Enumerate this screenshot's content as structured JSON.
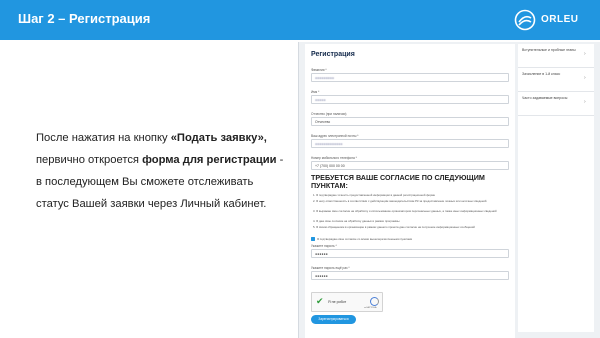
{
  "slide": {
    "title": "Шаг 2 – Регистрация",
    "logo_text": "ORLEU"
  },
  "description": {
    "line1_pre": "После нажатия на кнопку ",
    "line1_bold": "«Подать заявку»,",
    "line2_pre": "первично откроется ",
    "line2_bold": "форма для регистрации",
    "line2_post": " -",
    "line3": "в последующем Вы сможете отслеживать",
    "line4": "статус Вашей заявки через Личный кабинет."
  },
  "form": {
    "title": "Регистрация",
    "fields": [
      {
        "label": "Фамилия *",
        "value": "●●●●●●●●●"
      },
      {
        "label": "Имя *",
        "value": "●●●●●"
      },
      {
        "label": "Отчество (при наличии)",
        "value": "Отчество"
      },
      {
        "label": "Ваш адрес электронной почты *",
        "value": "●●●●●●●●●●●●●"
      },
      {
        "label": "Номер мобильного телефона *",
        "value": "+7 (700) 000 00 00"
      }
    ],
    "agree_title": "ТРЕБУЕТСЯ ВАШЕ СОГЛАСИЕ ПО СЛЕДУЮЩИМ ПУНКТАМ:",
    "consents": [
      "1. Я подтверждаю точность предоставленной информации в данной регистрационной форме",
      "2. Я несу ответственность в соответствии с действующим законодательством РК за предоставление ложных или неточных сведений",
      "3. Я выражаю свое согласие на обработку и использование организатором персональных данных, а также иных информационных сведений",
      "4. Я даю свое согласие на обработку данных в рамках программы",
      "5. Я своим обращением в организацию в рамках данного проекта даю согласие на получение информационных сообщений"
    ],
    "checkbox_label": "Я подтверждаю свое согласие со всеми вышеперечисленными пунктами",
    "password_label": "Укажите пароль *",
    "password_value": "●●●●●●",
    "password2_label": "Укажите пароль ещё раз *",
    "password2_value": "●●●●●●",
    "captcha_label": "Я не робот",
    "captcha_brand": "reCAPTCHA",
    "submit_label": "Зарегистрироваться"
  },
  "sidebar": {
    "items": [
      {
        "label": "Вступительные и пробные этапы"
      },
      {
        "label": "Зачисление в 1-й класс"
      },
      {
        "label": "Часто задаваемые вопросы"
      }
    ]
  },
  "colors": {
    "header_bg": "#2196e0",
    "accent": "#2196e0",
    "captcha_check": "#2e9b3a"
  }
}
